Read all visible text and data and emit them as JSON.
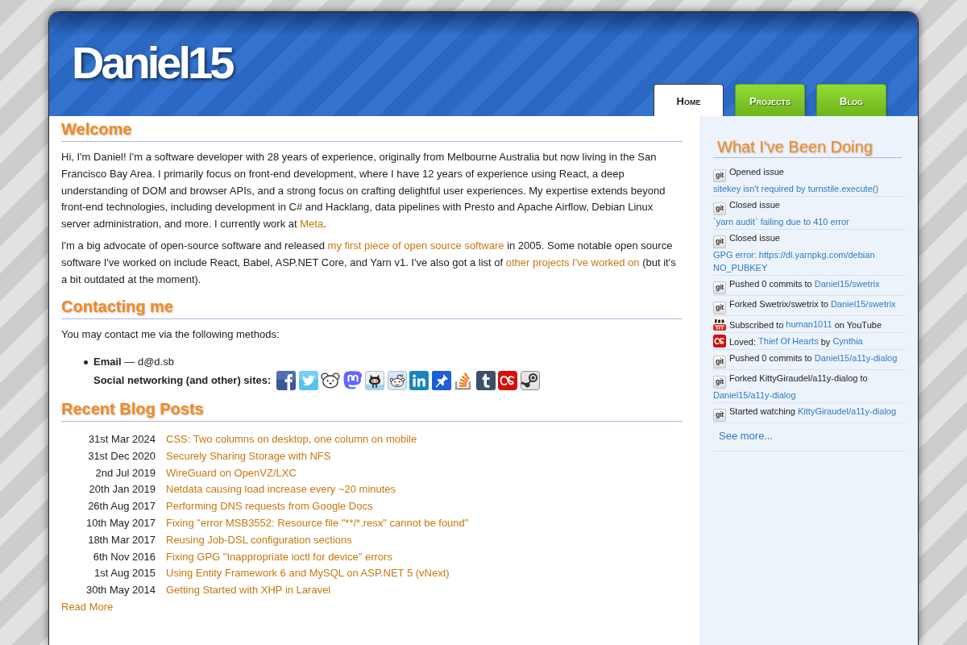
{
  "header": {
    "title": "Daniel15",
    "tabs": [
      {
        "label": "Home",
        "selected": true
      },
      {
        "label": "Projects",
        "selected": false
      },
      {
        "label": "Blog",
        "selected": false
      }
    ]
  },
  "welcome": {
    "heading": "Welcome",
    "paragraphs": [
      {
        "parts": [
          {
            "kind": "text",
            "text": "Hi, I'm Daniel! I'm a software developer with 28 years of experience, originally from Melbourne Australia but now living in the San Francisco Bay Area. I primarily focus on front-end development, where I have 12 years of experience using React, a deep understanding of DOM and browser APIs, and a strong focus on crafting delightful user experiences. My expertise extends beyond front-end technologies, including development in C# and Hacklang, data pipelines with Presto and Apache Airflow, Debian Linux server administration, and more. I currently work at "
          },
          {
            "kind": "link",
            "text": "Meta"
          },
          {
            "kind": "text",
            "text": "."
          }
        ]
      },
      {
        "parts": [
          {
            "kind": "text",
            "text": "I'm a big advocate of open-source software and released "
          },
          {
            "kind": "link",
            "text": "my first piece of open source software"
          },
          {
            "kind": "text",
            "text": " in 2005. Some notable open source software I've worked on include React, Babel, ASP.NET Core, and Yarn v1. I've also got a list of "
          },
          {
            "kind": "link",
            "text": "other projects I've worked on"
          },
          {
            "kind": "text",
            "text": " (but it's a bit outdated at the moment)."
          }
        ]
      }
    ]
  },
  "contact": {
    "heading": "Contacting me",
    "intro": "You may contact me via the following methods:",
    "email": "**Email** — d@d.sb",
    "social_label": "Social networking (and other) sites:"
  },
  "blog": {
    "heading": "Recent Blog Posts",
    "posts": [
      {
        "date": "31st Mar 2024",
        "title": "CSS: Two columns on desktop, one column on mobile"
      },
      {
        "date": "31st Dec 2020",
        "title": "Securely Sharing Storage with NFS"
      },
      {
        "date": "2nd Jul 2019",
        "title": "WireGuard on OpenVZ/LXC"
      },
      {
        "date": "20th Jan 2019",
        "title": "Netdata causing load increase every ~20 minutes"
      },
      {
        "date": "26th Aug 2017",
        "title": "Performing DNS requests from Google Docs"
      },
      {
        "date": "10th May 2017",
        "title": "Fixing \"error MSB3552: Resource file \"**/*.resx\" cannot be found\""
      },
      {
        "date": "18th Mar 2017",
        "title": "Reusing Job-DSL configuration sections"
      },
      {
        "date": "6th Nov 2016",
        "title": "Fixing GPG \"Inappropriate ioctl for device\" errors"
      },
      {
        "date": "1st Aug 2015",
        "title": "Using Entity Framework 6 and MySQL on ASP.NET 5 (vNext)"
      },
      {
        "date": "30th May 2014",
        "title": "Getting Started with XHP in Laravel"
      }
    ],
    "read_more": "Read More"
  },
  "sidebar": {
    "heading": "What I've Been Doing",
    "items": [
      {
        "kind": "git",
        "badge": "git",
        "parts": [
          {
            "kind": "text",
            "text": "Opened issue "
          },
          {
            "kind": "link",
            "text": "sitekey isn't required by turnstile.execute()"
          }
        ]
      },
      {
        "kind": "git",
        "badge": "git",
        "parts": [
          {
            "kind": "text",
            "text": "Closed issue "
          },
          {
            "kind": "link",
            "text": "`yarn audit` failing due to 410 error"
          }
        ]
      },
      {
        "kind": "git",
        "badge": "git",
        "parts": [
          {
            "kind": "text",
            "text": "Closed issue "
          },
          {
            "kind": "link",
            "text": "GPG error: https://dl.yarnpkg.com/debian NO_PUBKEY"
          }
        ]
      },
      {
        "kind": "git",
        "badge": "git",
        "parts": [
          {
            "kind": "text",
            "text": "Pushed 0 commits to "
          },
          {
            "kind": "link",
            "text": "Daniel15/swetrix"
          }
        ]
      },
      {
        "kind": "git",
        "badge": "git",
        "parts": [
          {
            "kind": "text",
            "text": "Forked Swetrix/swetrix to "
          },
          {
            "kind": "link",
            "text": "Daniel15/swetrix"
          }
        ]
      },
      {
        "kind": "youtube",
        "parts": [
          {
            "kind": "text",
            "text": "Subscribed to "
          },
          {
            "kind": "link",
            "text": "human1011"
          },
          {
            "kind": "text",
            "text": " on YouTube"
          }
        ]
      },
      {
        "kind": "lastfm",
        "parts": [
          {
            "kind": "text",
            "text": "Loved: "
          },
          {
            "kind": "link",
            "text": "Thief Of Hearts"
          },
          {
            "kind": "text",
            "text": " by "
          },
          {
            "kind": "link",
            "text": "Cynthia"
          }
        ]
      },
      {
        "kind": "git",
        "badge": "git",
        "parts": [
          {
            "kind": "text",
            "text": "Pushed 0 commits to "
          },
          {
            "kind": "link",
            "text": "Daniel15/a11y-dialog"
          }
        ]
      },
      {
        "kind": "git",
        "badge": "git",
        "parts": [
          {
            "kind": "text",
            "text": "Forked KittyGiraudel/a11y-dialog to "
          },
          {
            "kind": "link",
            "text": "Daniel15/a11y-dialog"
          }
        ]
      },
      {
        "kind": "git",
        "badge": "git",
        "parts": [
          {
            "kind": "text",
            "text": "Started watching "
          },
          {
            "kind": "link",
            "text": "KittyGiraudel/a11y-dialog"
          }
        ]
      }
    ],
    "see_more": "See more..."
  }
}
